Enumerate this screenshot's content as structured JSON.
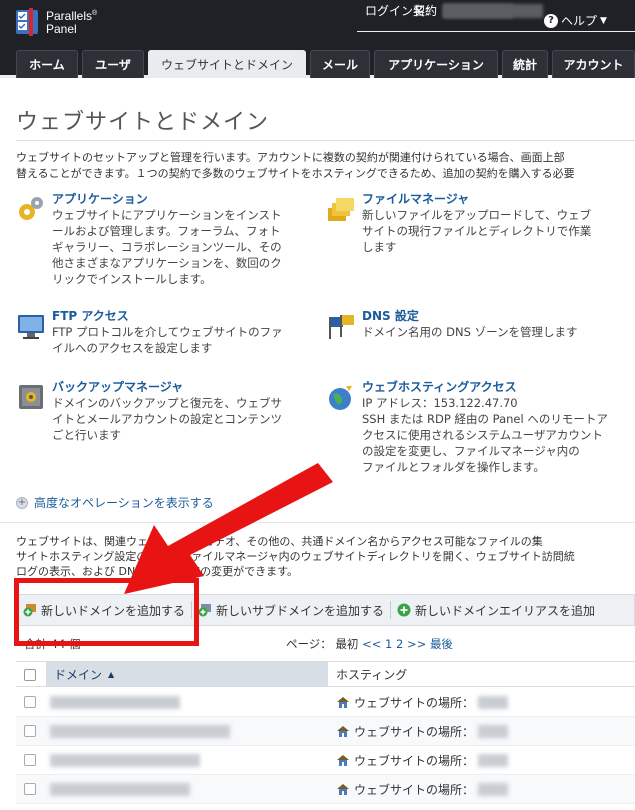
{
  "app": {
    "brand_line1": "Parallels",
    "brand_line2": "Panel",
    "login_label": "ログイン名：",
    "contract_label": "契約",
    "help_label": "ヘルプ"
  },
  "tabs": [
    {
      "label": "ホーム"
    },
    {
      "label": "ユーザ"
    },
    {
      "label": "ウェブサイトとドメイン"
    },
    {
      "label": "メール"
    },
    {
      "label": "アプリケーション"
    },
    {
      "label": "統計"
    },
    {
      "label": "アカウント"
    }
  ],
  "page": {
    "title": "ウェブサイトとドメイン",
    "intro_line1": "ウェブサイトのセットアップと管理を行います。アカウントに複数の契約が関連付けられている場合、画面上部",
    "intro_line2": "替えることができます。１つの契約で多数のウェブサイトをホスティングできるため、追加の契約を購入する必要"
  },
  "tools": [
    {
      "title": "アプリケーション",
      "desc": [
        "ウェブサイトにアプリケーションをインスト",
        "ールおよび管理します。フォーラム、フォト",
        "ギャラリー、コラボレーションツール、その",
        "他さまざまなアプリケーションを、数回のク",
        "リックでインストールします。"
      ],
      "icon": "gears-icon"
    },
    {
      "title": "ファイルマネージャ",
      "desc": [
        "新しいファイルをアップロードして、ウェブ",
        "サイトの現行ファイルとディレクトリで作業",
        "します"
      ],
      "icon": "folders-icon"
    },
    {
      "title": "FTP アクセス",
      "desc": [
        "FTP プロトコルを介してウェブサイトのファ",
        "イルへのアクセスを設定します"
      ],
      "icon": "ftp-monitor-icon"
    },
    {
      "title": "DNS 設定",
      "desc": [
        "ドメイン名用の DNS ゾーンを管理します"
      ],
      "icon": "dns-flags-icon"
    },
    {
      "title": "バックアップマネージャ",
      "desc": [
        "ドメインのバックアップと復元を、ウェブサ",
        "イトとメールアカウントの設定とコンテンツ",
        "ごと行います"
      ],
      "icon": "safe-icon"
    },
    {
      "title": "ウェブホスティングアクセス",
      "desc": [
        "IP アドレス：153.122.47.70",
        "SSH または RDP 経由の Panel へのリモートア",
        "クセスに使用されるシステムユーザアカウント",
        "の設定を変更し、ファイルマネージャ内の",
        "ファイルとフォルダを操作します。"
      ],
      "icon": "globe-icon"
    }
  ],
  "advanced": {
    "label": "高度なオペレーションを表示する"
  },
  "sites": {
    "desc_line1": "ウェブサイトは、関連ウェブ　　　　ビデオ、その他の、共通ドメイン名からアクセス可能なファイルの集",
    "desc_line2": "サイトホスティング設定の変更　ファイルマネージャ内のウェブサイトディレクトリを開く、ウェブサイト訪問統",
    "desc_line3": "ログの表示、および DNS ゾーン設定の変更ができます。"
  },
  "toolbar": {
    "add_domain": "新しいドメインを追加する",
    "add_subdomain": "新しいサブドメインを追加する",
    "add_alias": "新しいドメインエイリアスを追加"
  },
  "pager": {
    "count": "合計 44 個",
    "page_label": "ページ：",
    "first": "最初",
    "prev": "<<",
    "page1": "1",
    "page2": "2",
    "next": ">>",
    "last": "最後"
  },
  "table": {
    "col_domain": "ドメイン",
    "col_hosting": "ホスティング",
    "rows": [
      {
        "hosting": "ウェブサイトの場所："
      },
      {
        "hosting": "ウェブサイトの場所："
      },
      {
        "hosting": "ウェブサイトの場所："
      },
      {
        "hosting": "ウェブサイトの場所："
      }
    ]
  },
  "colors": {
    "header_bg": "#1f2126",
    "link": "#1a5b9c",
    "annotation_red": "#e81414"
  }
}
